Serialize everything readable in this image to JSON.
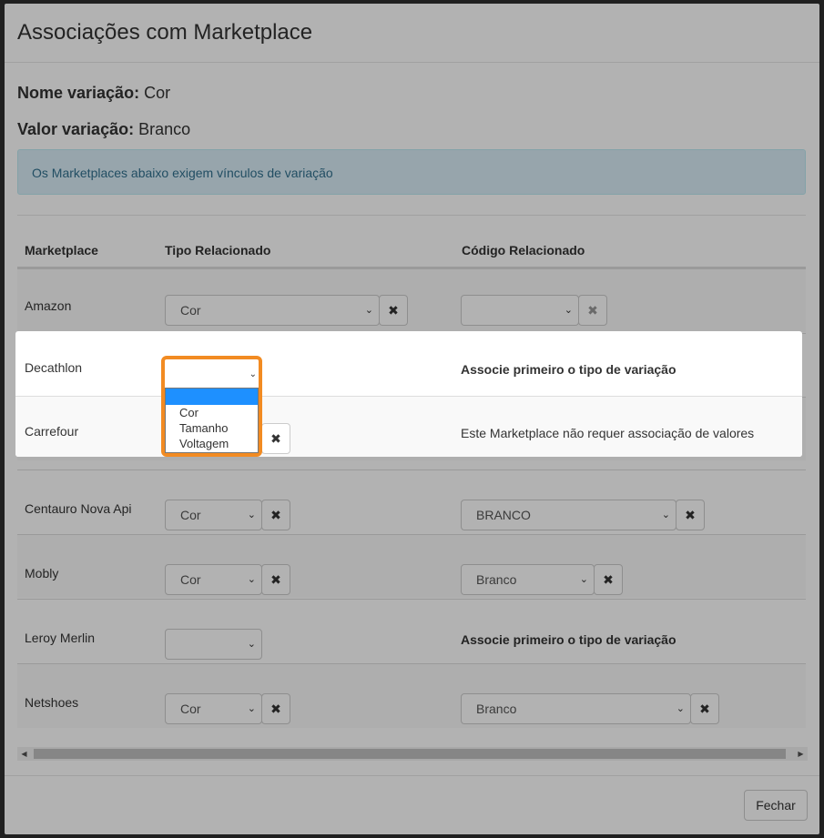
{
  "modal": {
    "title": "Associações com Marketplace",
    "variation_name_label": "Nome variação:",
    "variation_name_value": "Cor",
    "variation_value_label": "Valor variação:",
    "variation_value_value": "Branco",
    "alert_text": "Os Marketplaces abaixo exigem vínculos de variação",
    "close_label": "Fechar"
  },
  "table": {
    "headers": [
      "Marketplace",
      "Tipo Relacionado",
      "Código Relacionado"
    ],
    "rows": [
      {
        "marketplace": "Amazon",
        "type_value": "Cor",
        "code_value": ""
      },
      {
        "marketplace": "Decathlon",
        "type_value": "",
        "code_text": "Associe primeiro o tipo de variação"
      },
      {
        "marketplace": "Carrefour",
        "type_value": "",
        "code_text": "Este Marketplace não requer associação de valores"
      },
      {
        "marketplace": "Centauro Nova Api",
        "type_value": "Cor",
        "code_value": "BRANCO"
      },
      {
        "marketplace": "Mobly",
        "type_value": "Cor",
        "code_value": "Branco"
      },
      {
        "marketplace": "Leroy Merlin",
        "type_value": "",
        "code_text": "Associe primeiro o tipo de variação"
      },
      {
        "marketplace": "Netshoes",
        "type_value": "Cor",
        "code_value": "Branco"
      }
    ]
  },
  "dropdown": {
    "options": [
      "",
      "Cor",
      "Tamanho",
      "Voltagem"
    ],
    "selected_index": 0
  },
  "icons": {
    "clear": "✖",
    "chevron": "⌄",
    "scroll_left": "◀",
    "scroll_right": "▶"
  },
  "colors": {
    "alert_bg": "#d9edf7",
    "alert_text": "#31708f",
    "highlight_border": "#f28b22",
    "selected_option": "#1e90ff"
  }
}
